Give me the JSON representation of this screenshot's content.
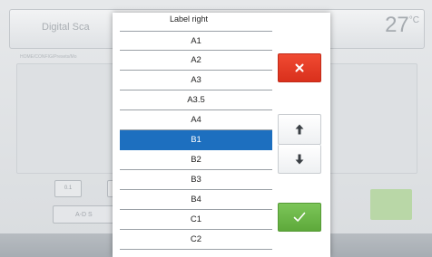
{
  "background": {
    "title": "Digital Sca",
    "temperature": "27",
    "temperature_unit": "°C",
    "path_text": "HOME/CONFIG/Presets/Mo",
    "small_button_label": "0.1",
    "wide_button_label": "A-D S"
  },
  "dialog": {
    "title": "Label right",
    "items": [
      "A1",
      "A2",
      "A3",
      "A3.5",
      "A4",
      "B1",
      "B2",
      "B3",
      "B4",
      "C1",
      "C2"
    ],
    "selected_item": "B1"
  },
  "colors": {
    "selected": "#1d6fbf",
    "cancel": "#e23d27",
    "confirm": "#6cb74a"
  },
  "icons": {
    "cancel": "close-icon",
    "up": "arrow-up-icon",
    "down": "arrow-down-icon",
    "confirm": "checkmark-icon"
  }
}
